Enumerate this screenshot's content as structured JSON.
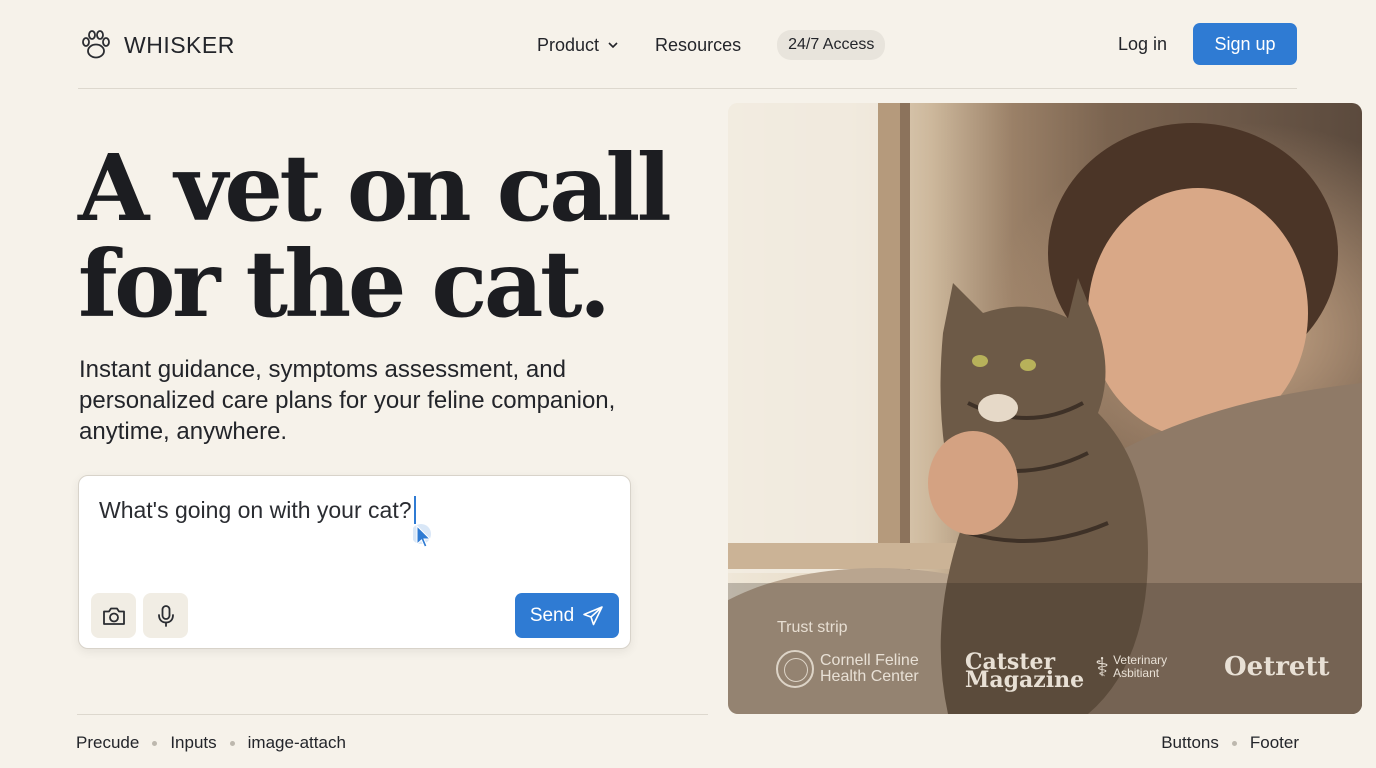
{
  "header": {
    "brand": "WHISKER",
    "nav": {
      "product": "Product",
      "resources": "Resources",
      "badge": "24/7 Access"
    },
    "login": "Log in",
    "signup": "Sign up"
  },
  "hero": {
    "title_line1": "A vet on call",
    "title_line2": "for the cat.",
    "subtitle": "Instant guidance, symptoms assessment, and personalized care plans for your feline companion, anytime, anywhere."
  },
  "composer": {
    "value": "What's going on with your cat?",
    "camera_icon": "camera-icon",
    "mic_icon": "microphone-icon",
    "send_label": "Send",
    "send_icon": "paper-plane-icon"
  },
  "trust": {
    "label": "Trust strip",
    "logos": [
      "Cornell Feline Health Center",
      "Catster Magazine",
      "Veterinary Asbitiant",
      "Oetrett"
    ]
  },
  "footer": {
    "left": [
      "Precude",
      "Inputs",
      "image-attach"
    ],
    "right": [
      "Buttons",
      "Footer"
    ]
  },
  "colors": {
    "background": "#f6f2ea",
    "accent": "#2f7bd3",
    "text": "#1d1d1f"
  }
}
